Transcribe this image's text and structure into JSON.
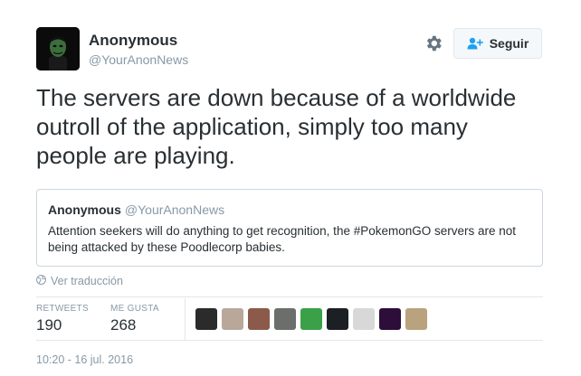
{
  "author": {
    "name": "Anonymous",
    "handle": "@YourAnonNews",
    "avatar_icon": "anonymous-mask-avatar"
  },
  "header_actions": {
    "settings_icon": "gear-icon",
    "follow_label": "Seguir",
    "follow_icon": "person-add-icon"
  },
  "tweet": {
    "text": "The servers are down because of a worldwide outroll of the application, simply too many people are playing."
  },
  "quoted_tweet": {
    "name": "Anonymous",
    "handle": "@YourAnonNews",
    "text": "Attention seekers will do anything to get recognition, the #PokemonGO servers are not being attacked by these Poodlecorp babies."
  },
  "translate": {
    "label": "Ver traducción",
    "icon": "globe-icon"
  },
  "stats": {
    "retweets_label": "RETWEETS",
    "retweets_value": "190",
    "likes_label": "ME GUSTA",
    "likes_value": "268"
  },
  "likers": [
    {
      "name": "liker-avatar-1",
      "color": "#2b2b2b"
    },
    {
      "name": "liker-avatar-2",
      "color": "#b9a79a"
    },
    {
      "name": "liker-avatar-3",
      "color": "#8c5a4a"
    },
    {
      "name": "liker-avatar-4",
      "color": "#6b6e6a"
    },
    {
      "name": "liker-avatar-5",
      "color": "#3aa148"
    },
    {
      "name": "liker-avatar-6",
      "color": "#1c1f24"
    },
    {
      "name": "liker-avatar-7",
      "color": "#d8d8d8"
    },
    {
      "name": "liker-avatar-8",
      "color": "#2d0e3a"
    },
    {
      "name": "liker-avatar-9",
      "color": "#b9a27e"
    }
  ],
  "timestamp": "10:20 - 16 jul. 2016",
  "colors": {
    "text": "#292f33",
    "muted": "#8899a6",
    "border": "#e1e8ed",
    "accent": "#1da1f2"
  }
}
